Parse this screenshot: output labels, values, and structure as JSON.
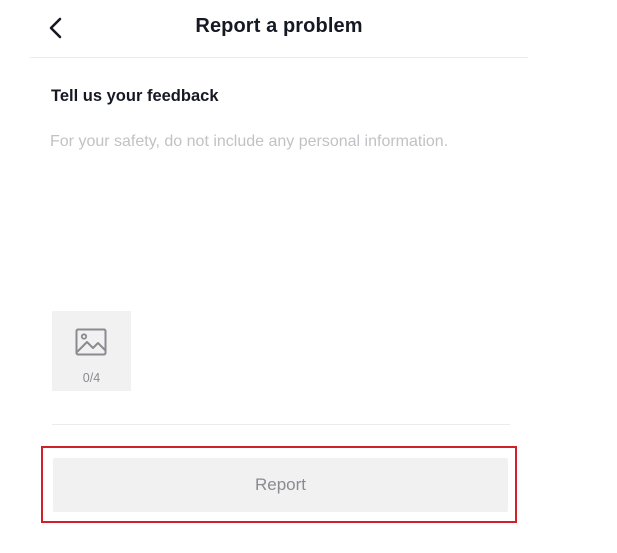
{
  "header": {
    "back_icon": "chevron-left-icon",
    "title": "Report a problem"
  },
  "feedback": {
    "heading": "Tell us your feedback",
    "value": "",
    "placeholder": "For your safety, do not include any personal information."
  },
  "attachments": {
    "icon": "image-icon",
    "count_label": "0/4"
  },
  "footer": {
    "report_label": "Report",
    "highlight_color": "#d0202a"
  }
}
